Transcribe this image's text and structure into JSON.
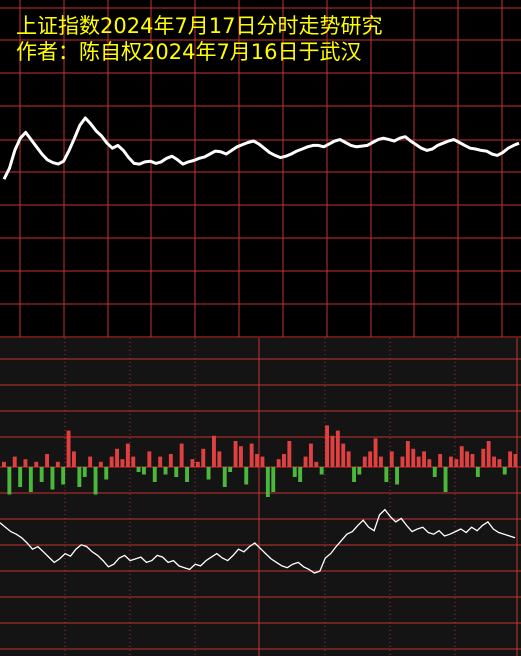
{
  "header": {
    "title": "上证指数2024年7月17日分时走势研究",
    "subtitle": "作者：陈自权2024年7月16日于武汉"
  },
  "colors": {
    "background_top": "#000000",
    "background_bottom": "#141414",
    "grid_line": "#c83232",
    "grid_dotted": "#a03232",
    "price_line": "#ffffff",
    "indicator_line": "#ffffff",
    "bar_up": "#e04040",
    "bar_down": "#4ab83a",
    "title_text": "#ffff00"
  },
  "chart_data": [
    {
      "type": "line",
      "series": [
        {
          "values": [
            0.15,
            0.3,
            0.55,
            0.72,
            0.8,
            0.7,
            0.6,
            0.5,
            0.42,
            0.38,
            0.36,
            0.4,
            0.55,
            0.72,
            0.9,
            1.0,
            0.92,
            0.82,
            0.75,
            0.65,
            0.58,
            0.62,
            0.55,
            0.45,
            0.37,
            0.36,
            0.39,
            0.4,
            0.37,
            0.39,
            0.44,
            0.47,
            0.42,
            0.36,
            0.39,
            0.41,
            0.44,
            0.46,
            0.5,
            0.54,
            0.53,
            0.5,
            0.55,
            0.6,
            0.63,
            0.66,
            0.68,
            0.64,
            0.58,
            0.52,
            0.48,
            0.45,
            0.47,
            0.5,
            0.54,
            0.57,
            0.6,
            0.62,
            0.62,
            0.6,
            0.64,
            0.68,
            0.7,
            0.66,
            0.62,
            0.6,
            0.61,
            0.62,
            0.66,
            0.7,
            0.72,
            0.7,
            0.68,
            0.72,
            0.74,
            0.68,
            0.63,
            0.58,
            0.55,
            0.57,
            0.62,
            0.65,
            0.68,
            0.7,
            0.66,
            0.62,
            0.58,
            0.57,
            0.55,
            0.54,
            0.5,
            0.48,
            0.52,
            0.58,
            0.62,
            0.65
          ]
        }
      ],
      "ylim": [
        0,
        1
      ],
      "grid": true
    },
    {
      "type": "bar",
      "values": [
        0.1,
        -0.55,
        0.2,
        -0.4,
        0.15,
        -0.5,
        0.1,
        -0.3,
        0.25,
        -0.45,
        0.1,
        -0.35,
        0.7,
        0.3,
        -0.4,
        -0.2,
        0.2,
        -0.55,
        0.1,
        -0.25,
        0.2,
        0.35,
        0.15,
        0.45,
        0.2,
        -0.1,
        -0.15,
        0.3,
        -0.3,
        0.2,
        -0.15,
        0.25,
        -0.2,
        0.45,
        -0.3,
        0.15,
        0.1,
        0.35,
        -0.25,
        0.6,
        0.3,
        -0.4,
        -0.1,
        0.5,
        0.4,
        -0.35,
        0.45,
        0.25,
        0.2,
        -0.6,
        -0.5,
        0.15,
        0.25,
        0.5,
        -0.2,
        -0.3,
        0.2,
        0.45,
        0.1,
        -0.15,
        0.8,
        0.6,
        0.7,
        0.45,
        0.3,
        -0.3,
        -0.15,
        0.2,
        0.3,
        0.55,
        0.2,
        -0.3,
        0.3,
        -0.35,
        0.2,
        0.5,
        0.35,
        0.2,
        0.3,
        0.15,
        -0.2,
        0.25,
        -0.5,
        0.2,
        0.15,
        0.4,
        0.3,
        0.25,
        -0.2,
        0.35,
        0.5,
        0.2,
        0.15,
        -0.15,
        0.3,
        0.25
      ],
      "grid": true
    },
    {
      "type": "line",
      "series": [
        {
          "values": [
            0.65,
            0.6,
            0.55,
            0.52,
            0.48,
            0.42,
            0.35,
            0.38,
            0.32,
            0.26,
            0.2,
            0.24,
            0.3,
            0.27,
            0.35,
            0.4,
            0.38,
            0.32,
            0.28,
            0.22,
            0.15,
            0.18,
            0.25,
            0.28,
            0.22,
            0.24,
            0.26,
            0.2,
            0.22,
            0.28,
            0.26,
            0.2,
            0.22,
            0.16,
            0.14,
            0.12,
            0.18,
            0.16,
            0.22,
            0.26,
            0.3,
            0.25,
            0.22,
            0.28,
            0.35,
            0.32,
            0.38,
            0.42,
            0.36,
            0.3,
            0.24,
            0.2,
            0.16,
            0.14,
            0.18,
            0.2,
            0.15,
            0.12,
            0.08,
            0.1,
            0.25,
            0.3,
            0.38,
            0.45,
            0.52,
            0.55,
            0.62,
            0.68,
            0.6,
            0.56,
            0.74,
            0.8,
            0.72,
            0.66,
            0.7,
            0.62,
            0.55,
            0.58,
            0.6,
            0.54,
            0.52,
            0.56,
            0.5,
            0.52,
            0.55,
            0.58,
            0.54,
            0.6,
            0.56,
            0.62,
            0.66,
            0.58,
            0.54,
            0.52,
            0.5,
            0.48
          ],
          "ylim": [
            0,
            1
          ]
        }
      ],
      "grid": true
    }
  ]
}
